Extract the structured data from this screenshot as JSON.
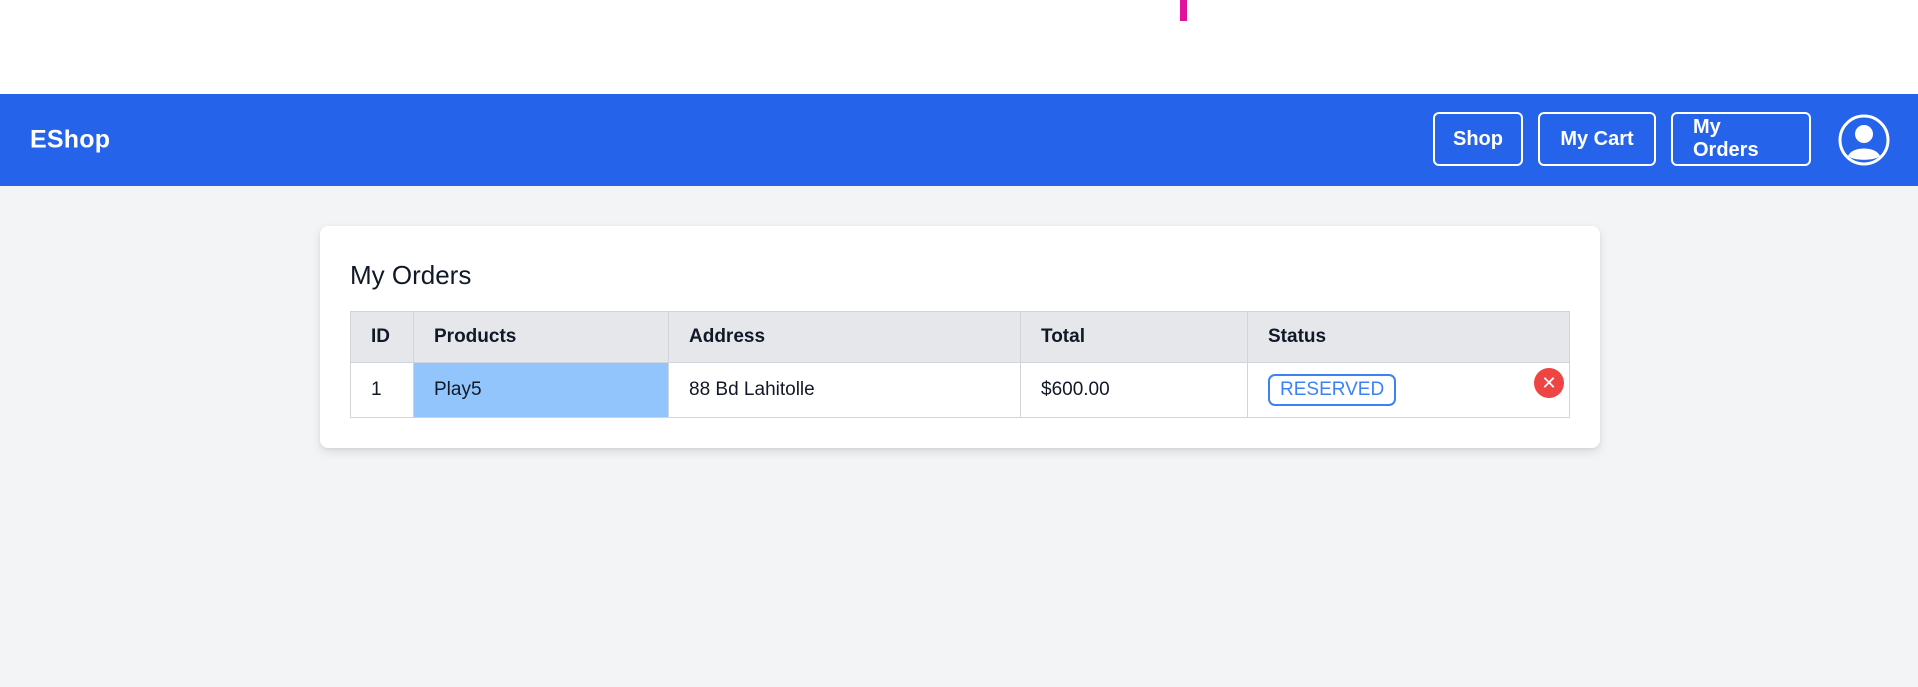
{
  "app": {
    "brand": "EShop"
  },
  "nav": {
    "shop_label": "Shop",
    "cart_label": "My Cart",
    "orders_label": "My Orders",
    "profile_icon": "user-circle-icon"
  },
  "orders_page": {
    "title": "My Orders",
    "columns": [
      "ID",
      "Products",
      "Address",
      "Total",
      "Status"
    ],
    "rows": [
      {
        "id": "1",
        "products": "Play5",
        "address": "88 Bd Lahitolle",
        "total": "$600.00",
        "status": "RESERVED",
        "cancel_icon": "close-icon"
      }
    ]
  },
  "colors": {
    "navbar": "#2563eb",
    "page_background": "#f3f4f6",
    "status_badge": "#3b82f6",
    "cancel_button": "#ef4444",
    "product_cell_highlight": "#93c5fd"
  }
}
